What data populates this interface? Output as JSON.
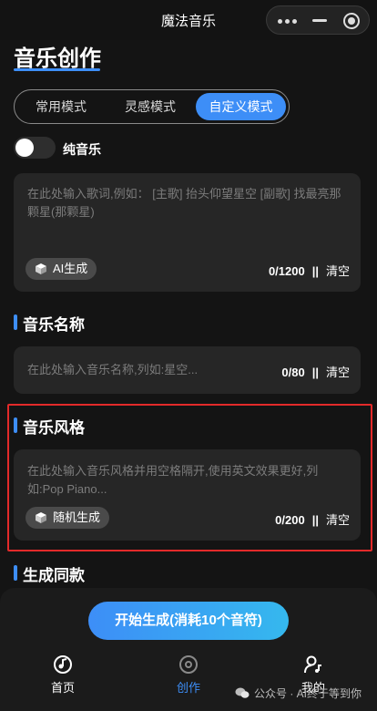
{
  "app": {
    "title": "魔法音乐"
  },
  "page": {
    "title": "音乐创作"
  },
  "modes": {
    "tabs": [
      {
        "label": "常用模式",
        "active": false
      },
      {
        "label": "灵感模式",
        "active": false
      },
      {
        "label": "自定义模式",
        "active": true
      }
    ]
  },
  "pure_music": {
    "label": "纯音乐",
    "enabled": false
  },
  "lyrics": {
    "placeholder": "在此处输入歌词,例如： [主歌] 抬头仰望星空 [副歌] 找最亮那颗星(那颗星)",
    "ai_button": "AI生成",
    "count": "0/1200",
    "separator": "||",
    "clear": "清空"
  },
  "music_name": {
    "section_title": "音乐名称",
    "placeholder": "在此处输入音乐名称,列如:星空...",
    "count": "0/80",
    "separator": "||",
    "clear": "清空"
  },
  "music_style": {
    "section_title": "音乐风格",
    "placeholder": "在此处输入音乐风格并用空格隔开,使用英文效果更好,列如:Pop Piano...",
    "random_button": "随机生成",
    "count": "0/200",
    "separator": "||",
    "clear": "清空"
  },
  "same_style": {
    "section_title": "生成同款"
  },
  "generate_button": "开始生成(消耗10个音符)",
  "bottom_nav": {
    "items": [
      {
        "label": "首页",
        "icon": "music-disc-icon",
        "active": false
      },
      {
        "label": "创作",
        "icon": "vinyl-icon",
        "active": true
      },
      {
        "label": "我的",
        "icon": "user-music-icon",
        "active": false
      }
    ]
  },
  "watermark": "公众号 · AI终于等到你",
  "colors": {
    "accent": "#3d8ef7",
    "background": "#141414",
    "card": "#262626",
    "highlight": "#e22a2a"
  }
}
